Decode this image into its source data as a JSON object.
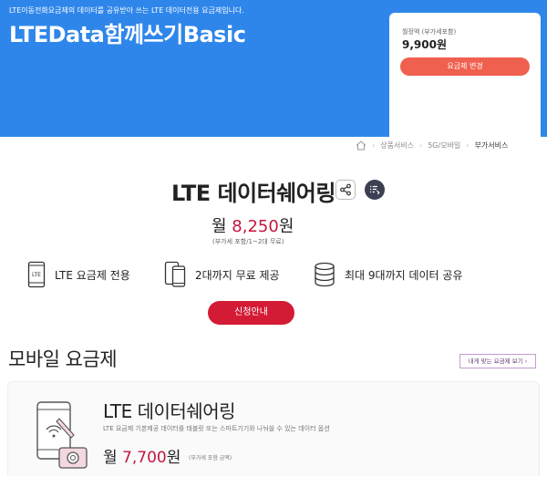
{
  "top": {
    "description": "LTE이동전화요금제의 데이터를 공유받아 쓰는 LTE 데이터전용 요금제입니다.",
    "plan_name": "LTEData함께쓰기Basic",
    "price_label": "월정액 (부가세포함)",
    "price_value": "9,900원",
    "change_button": "요금제 변경"
  },
  "breadcrumb": {
    "items": [
      "상품서비스",
      "5G/모바일",
      "부가서비스"
    ],
    "separator": "›"
  },
  "product": {
    "title": "LTE 데이터쉐어링",
    "fee_prefix": "월",
    "fee_amount": "8,250",
    "fee_suffix": "원",
    "fee_note": "(부가세 포함/1~2대 무료)",
    "features": [
      {
        "icon": "lte-phone-icon",
        "text": "LTE 요금제 전용"
      },
      {
        "icon": "two-devices-icon",
        "text": "2대까지 무료 제공"
      },
      {
        "icon": "database-icon",
        "text": "최대 9대까지 데이터 공유"
      }
    ],
    "apply_button": "신청안내"
  },
  "mobile_plan": {
    "section_title": "모바일 요금제",
    "find_button": "내게 맞는 요금제 보기 ›",
    "card": {
      "illustration": "phone-camera-icon",
      "name": "LTE 데이터쉐어링",
      "description": "LTE 요금제 기본제공 데이터를 태블릿 또는 스마트기기와 나눠쓸 수 있는 데이터 옵션",
      "fee_prefix": "월",
      "fee_amount": "7,700",
      "fee_suffix": "원",
      "fee_note": "(부가세 포함 금액)"
    }
  },
  "colors": {
    "banner_blue": "#2f86ea",
    "change_button": "#f0604e",
    "accent_red": "#c4163f",
    "apply_button": "#d41b35",
    "dark_button": "#3d3f53"
  }
}
